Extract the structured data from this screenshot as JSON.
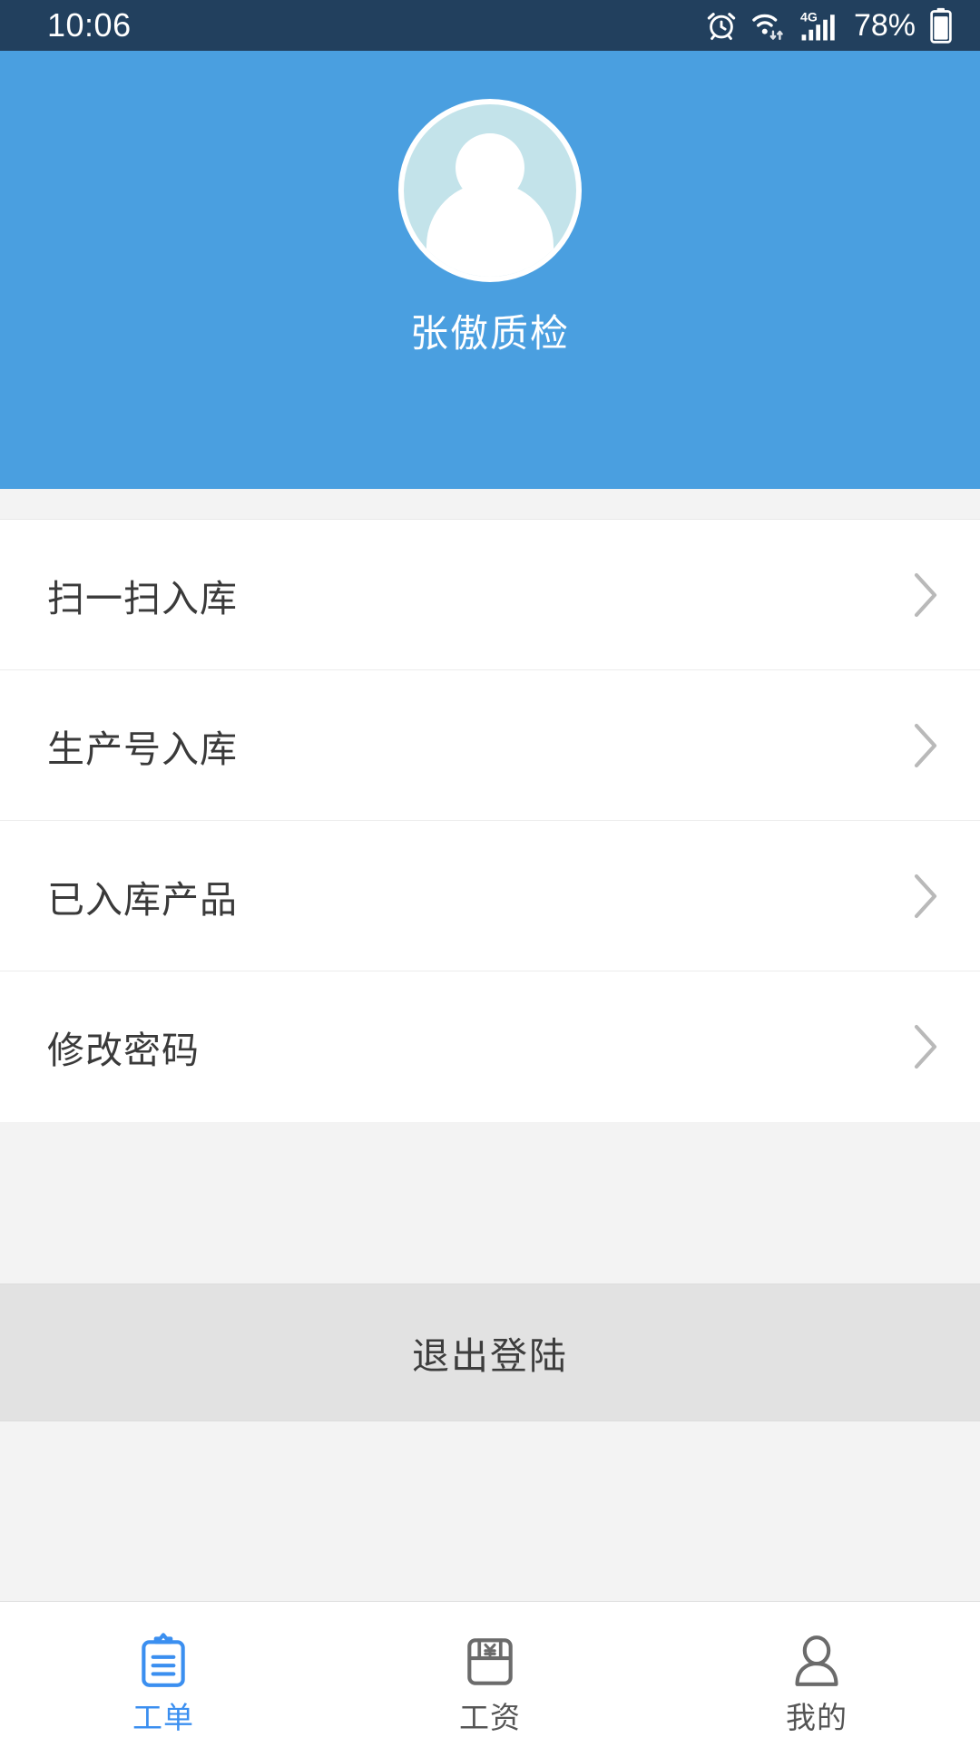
{
  "status_bar": {
    "time": "10:06",
    "battery_percent": "78%",
    "icons": [
      "alarm-clock-icon",
      "wifi-icon",
      "4g-signal-icon",
      "battery-icon"
    ],
    "network_label": "4G",
    "background_color": "#22405e",
    "text_color": "#ffffff"
  },
  "profile": {
    "name": "张傲质检",
    "avatar_icon": "user-avatar-icon",
    "header_color": "#4a9fe0",
    "avatar_bg_color": "#c3e3ea"
  },
  "menu": {
    "items": [
      {
        "label": "扫一扫入库",
        "chevron": "chevron-right-icon"
      },
      {
        "label": "生产号入库",
        "chevron": "chevron-right-icon"
      },
      {
        "label": "已入库产品",
        "chevron": "chevron-right-icon"
      },
      {
        "label": "修改密码",
        "chevron": "chevron-right-icon"
      }
    ]
  },
  "logout": {
    "label": "退出登陆",
    "background_color": "#e2e2e2"
  },
  "bottom_nav": {
    "active_color": "#3b8ff0",
    "inactive_color": "#555555",
    "tabs": [
      {
        "label": "工单",
        "icon": "clipboard-icon",
        "active": true
      },
      {
        "label": "工资",
        "icon": "wallet-yuan-icon",
        "active": false
      },
      {
        "label": "我的",
        "icon": "person-icon",
        "active": false
      }
    ]
  }
}
